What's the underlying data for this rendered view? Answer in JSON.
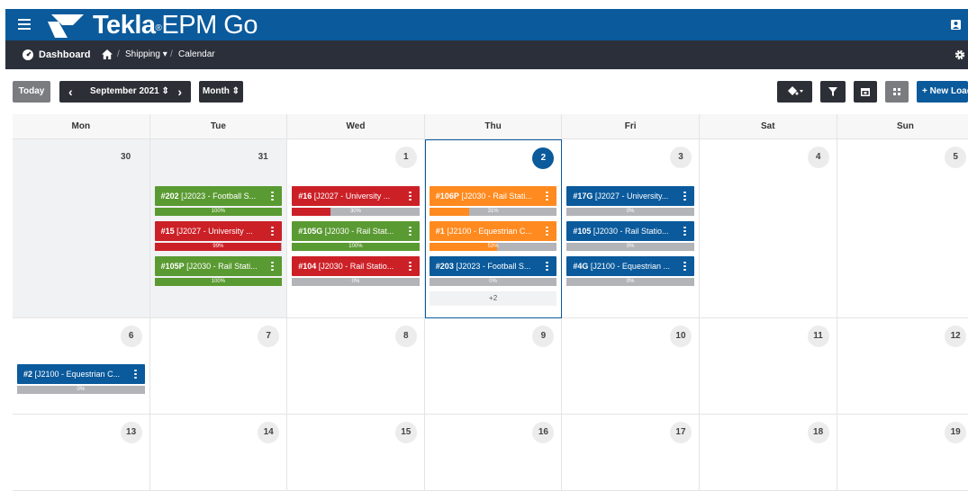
{
  "app": {
    "brand_main": "Tekla",
    "brand_sep": "®",
    "brand_product": "EPM Go"
  },
  "breadcrumb": {
    "dashboard": "Dashboard",
    "shipping": "Shipping ▾",
    "calendar": "Calendar",
    "separator": "/"
  },
  "toolbar": {
    "today": "Today",
    "period": "September 2021 ⇕",
    "view": "Month ⇕",
    "new_load": "+ New Load",
    "prev_icon": "‹",
    "next_icon": "›"
  },
  "calendar": {
    "weekdays": [
      "Mon",
      "Tue",
      "Wed",
      "Thu",
      "Fri",
      "Sat",
      "Sun"
    ],
    "weeks": [
      [
        "30",
        "31",
        "1",
        "2",
        "3",
        "4",
        "5"
      ],
      [
        "6",
        "7",
        "8",
        "9",
        "10",
        "11",
        "12"
      ],
      [
        "13",
        "14",
        "15",
        "16",
        "17",
        "18",
        "19"
      ]
    ],
    "more_label": "+2"
  },
  "loads": [
    {
      "id": "#202",
      "text": " [J2023 - Football S...",
      "pct": "100%",
      "progress": 1.0,
      "color": "green"
    },
    {
      "id": "#15",
      "text": " [J2027 - University ...",
      "pct": "99%",
      "progress": 0.99,
      "color": "red"
    },
    {
      "id": "#105P",
      "text": " [J2030 - Rail Stati...",
      "pct": "100%",
      "progress": 1.0,
      "color": "green"
    },
    {
      "id": "#16",
      "text": " [J2027 - University ...",
      "pct": "30%",
      "progress": 0.3,
      "color": "red"
    },
    {
      "id": "#105G",
      "text": " [J2030 - Rail Stat...",
      "pct": "100%",
      "progress": 1.0,
      "color": "green"
    },
    {
      "id": "#104",
      "text": " [J2030 - Rail Statio...",
      "pct": "0%",
      "progress": 0,
      "color": "red"
    },
    {
      "id": "#106P",
      "text": " [J2030 - Rail Stati...",
      "pct": "31%",
      "progress": 0.31,
      "color": "orange"
    },
    {
      "id": "#1",
      "text": " [J2100 - Equestrian C...",
      "pct": "53%",
      "progress": 0.53,
      "color": "orange"
    },
    {
      "id": "#203",
      "text": " [J2023 - Football S...",
      "pct": "0%",
      "progress": 0,
      "color": "blue"
    },
    {
      "id": "#17G",
      "text": " [J2027 - University...",
      "pct": "0%",
      "progress": 0,
      "color": "blue"
    },
    {
      "id": "#105",
      "text": " [J2030 - Rail Statio...",
      "pct": "0%",
      "progress": 0,
      "color": "blue"
    },
    {
      "id": "#4G",
      "text": " [J2100 - Equestrian ...",
      "pct": "0%",
      "progress": 0,
      "color": "blue"
    },
    {
      "id": "#2",
      "text": " [J2100 - Equestrian C...",
      "pct": "0%",
      "progress": 0,
      "color": "blue"
    }
  ],
  "colors": {
    "brand": "#0a5a9c",
    "green": "#5a9a32",
    "red": "#cc2027",
    "orange": "#ff8a1f",
    "blue": "#0a5a9c"
  },
  "icons": [
    "hamburger-icon",
    "tekla-logo-icon",
    "user-icon",
    "dashboard-icon",
    "home-icon",
    "gear-icon",
    "chevron-left-icon",
    "chevron-right-icon",
    "paint-bucket-icon",
    "filter-icon",
    "calendar-icon",
    "grid-icon",
    "more-vertical-icon"
  ]
}
